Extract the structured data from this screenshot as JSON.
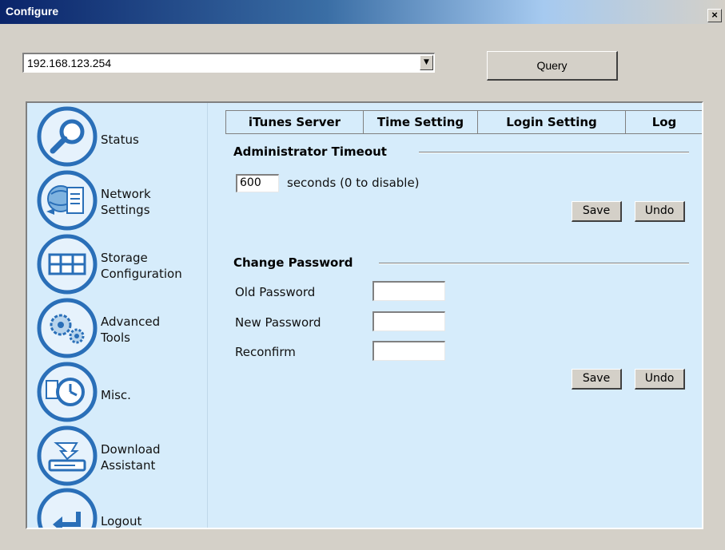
{
  "window": {
    "title": "Configure",
    "close_label": "×"
  },
  "address": {
    "value": "192.168.123.254",
    "dropdown_glyph": "▼"
  },
  "query_label": "Query",
  "sidebar": {
    "items": [
      {
        "id": "status",
        "label_lines": [
          "Status"
        ],
        "icon": "magnifier-icon"
      },
      {
        "id": "network",
        "label_lines": [
          "Network",
          "Settings"
        ],
        "icon": "globe-network-icon"
      },
      {
        "id": "storage",
        "label_lines": [
          "Storage",
          "Configuration"
        ],
        "icon": "storage-grid-icon"
      },
      {
        "id": "advanced",
        "label_lines": [
          "Advanced",
          "Tools"
        ],
        "icon": "gears-icon"
      },
      {
        "id": "misc",
        "label_lines": [
          "Misc."
        ],
        "icon": "clock-icon"
      },
      {
        "id": "download",
        "label_lines": [
          "Download",
          "Assistant"
        ],
        "icon": "download-tray-icon"
      },
      {
        "id": "logout",
        "label_lines": [
          "Logout"
        ],
        "icon": "return-arrow-icon"
      }
    ]
  },
  "tabs": [
    "iTunes Server",
    "Time Setting",
    "Login Setting",
    "Log"
  ],
  "active_tab": "Login Setting",
  "admin_timeout": {
    "title": "Administrator Timeout",
    "value": "600",
    "suffix": "seconds (0 to disable)",
    "save_label": "Save",
    "undo_label": "Undo"
  },
  "change_password": {
    "title": "Change Password",
    "old_label": "Old Password",
    "new_label": "New Password",
    "confirm_label": "Reconfirm",
    "save_label": "Save",
    "undo_label": "Undo"
  },
  "colors": {
    "panel_bg": "#d6ecfb",
    "icon_ring": "#2a6fb8",
    "icon_fill": "#e6f2fc"
  }
}
